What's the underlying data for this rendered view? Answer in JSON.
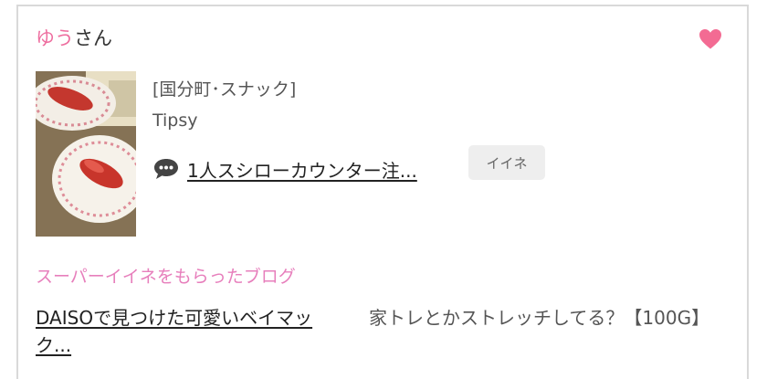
{
  "post": {
    "user_name": "ゆう",
    "user_suffix": "さん",
    "category": "[国分町･スナック]",
    "shop_name": "Tipsy",
    "comment_link": "1人スシローカウンター注...",
    "iine_label": "イイネ"
  },
  "super_iine": {
    "title": "スーパーイイネをもらったブログ",
    "blogs": [
      {
        "label": "DAISOで見つけた可愛いベイマック..."
      },
      {
        "label": "家トレとかストレッチしてる？【100G】"
      }
    ]
  },
  "icons": {
    "heart": "heart-icon",
    "comment": "speech-bubble-icon"
  },
  "colors": {
    "accent_pink": "#ee6fa0",
    "heart": "#f36b93",
    "section_title": "#e77fbc",
    "button_bg": "#eeeeee",
    "border": "#d9d9d9"
  }
}
